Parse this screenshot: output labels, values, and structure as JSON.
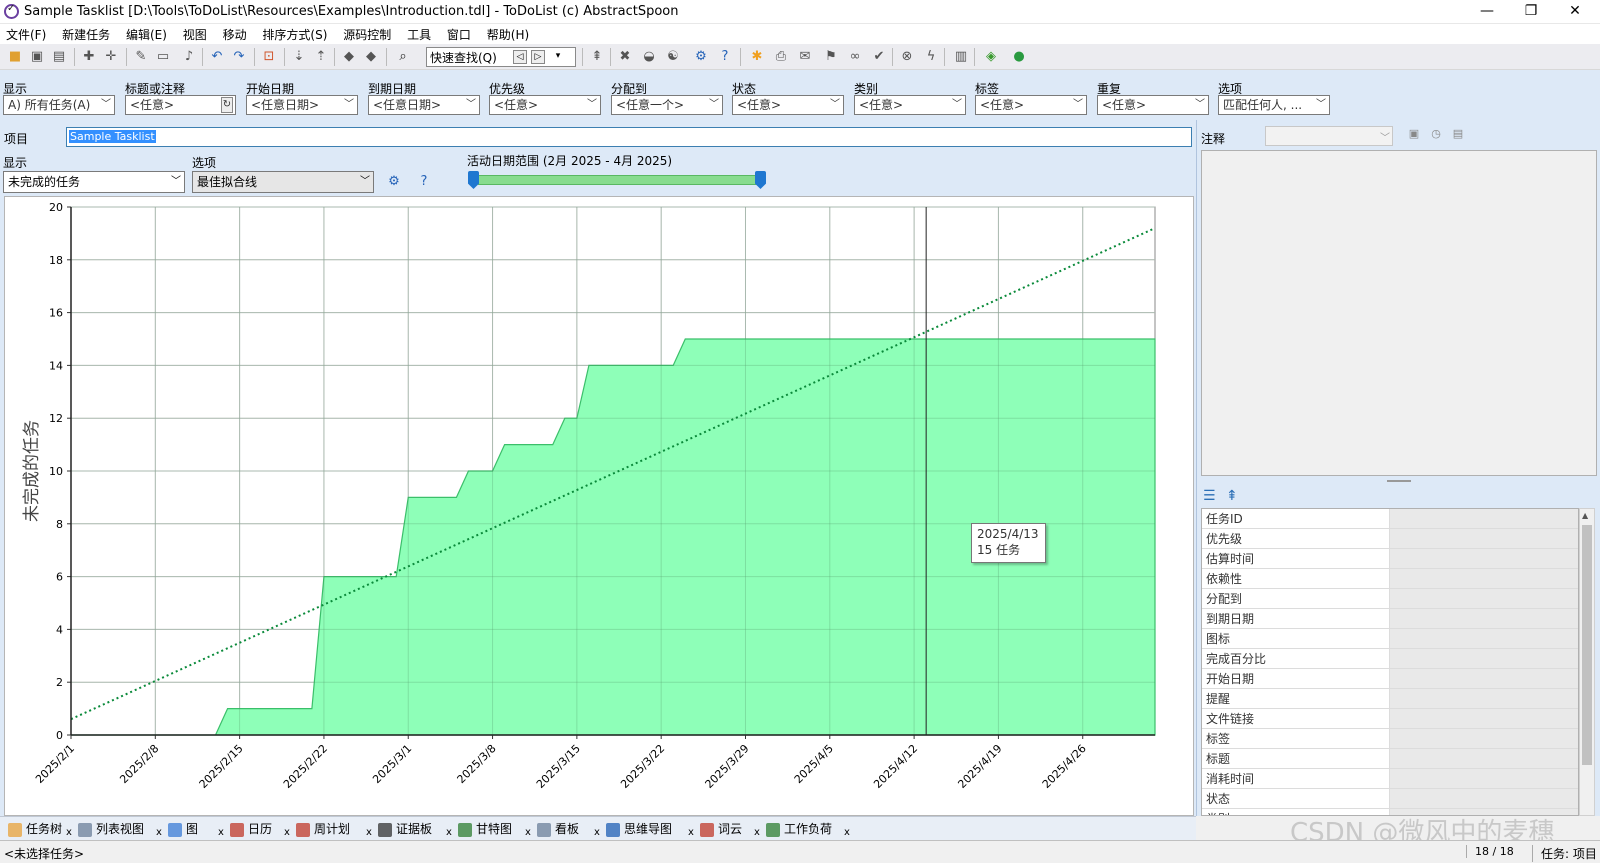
{
  "window": {
    "title": "Sample Tasklist [D:\\Tools\\ToDoList\\Resources\\Examples\\Introduction.tdl] - ToDoList (c) AbstractSpoon",
    "minimize": "—",
    "restore": "❐",
    "close": "✕"
  },
  "menu": [
    "文件(F)",
    "新建任务",
    "编辑(E)",
    "视图",
    "移动",
    "排序方式(S)",
    "源码控制",
    "工具",
    "窗口",
    "帮助(H)"
  ],
  "toolbar": {
    "quick_find": "快速查找(Q)"
  },
  "filters": [
    {
      "label": "显示",
      "value": "A)  所有任务(A)"
    },
    {
      "label": "标题或注释",
      "value": "<任意>"
    },
    {
      "label": "开始日期",
      "value": "<任意日期>"
    },
    {
      "label": "到期日期",
      "value": "<任意日期>"
    },
    {
      "label": "优先级",
      "value": "<任意>"
    },
    {
      "label": "分配到",
      "value": "<任意一个>"
    },
    {
      "label": "状态",
      "value": "<任意>"
    },
    {
      "label": "类别",
      "value": "<任意>"
    },
    {
      "label": "标签",
      "value": "<任意>"
    },
    {
      "label": "重复",
      "value": "<任意>"
    },
    {
      "label": "选项",
      "value": "匹配任何人, ..."
    }
  ],
  "project": {
    "label": "项目",
    "name": "Sample Tasklist"
  },
  "graph_controls": {
    "display_label": "显示",
    "display_value": "未完成的任务",
    "option_label": "选项",
    "option_value": "最佳拟合线",
    "range_label": "活动日期范围 (2月 2025 - 4月 2025)"
  },
  "tooltip": {
    "date": "2025/4/13",
    "count": "15 任务"
  },
  "chart_data": {
    "type": "area",
    "ylabel": "未完成的任务",
    "ylim": [
      0,
      20
    ],
    "yticks": [
      "0",
      "2",
      "4",
      "6",
      "8",
      "10",
      "12",
      "14",
      "16",
      "18",
      "20"
    ],
    "xticks": [
      "2025/2/1",
      "2025/2/8",
      "2025/2/15",
      "2025/2/22",
      "2025/3/1",
      "2025/3/8",
      "2025/3/15",
      "2025/3/22",
      "2025/3/29",
      "2025/4/5",
      "2025/4/12",
      "2025/4/19",
      "2025/4/26"
    ],
    "xrange": [
      "2025/2/1",
      "2025/5/2"
    ],
    "series": [
      {
        "type": "area",
        "color": "#88ffb4",
        "points": [
          [
            "2025/2/1",
            0
          ],
          [
            "2025/2/13",
            0
          ],
          [
            "2025/2/14",
            1
          ],
          [
            "2025/2/21",
            1
          ],
          [
            "2025/2/22",
            6
          ],
          [
            "2025/2/28",
            6
          ],
          [
            "2025/3/1",
            9
          ],
          [
            "2025/3/5",
            9
          ],
          [
            "2025/3/6",
            10
          ],
          [
            "2025/3/8",
            10
          ],
          [
            "2025/3/9",
            11
          ],
          [
            "2025/3/13",
            11
          ],
          [
            "2025/3/14",
            12
          ],
          [
            "2025/3/15",
            12
          ],
          [
            "2025/3/16",
            14
          ],
          [
            "2025/3/23",
            14
          ],
          [
            "2025/3/24",
            15
          ],
          [
            "2025/5/2",
            15
          ]
        ]
      },
      {
        "type": "trend",
        "color": "#0a8a3a",
        "points": [
          [
            "2025/2/1",
            0.6
          ],
          [
            "2025/5/2",
            19.2
          ]
        ]
      }
    ],
    "marker_date": "2025/4/13",
    "grid": true
  },
  "notes_panel": {
    "label": "注释"
  },
  "properties": [
    "任务ID",
    "优先级",
    "估算时间",
    "依赖性",
    "分配到",
    "到期日期",
    "图标",
    "完成百分比",
    "开始日期",
    "提醒",
    "文件链接",
    "标签",
    "标题",
    "消耗时间",
    "状态",
    "类别"
  ],
  "tabs": [
    {
      "label": "任务树",
      "icon": "task-tree-icon",
      "color": "#e8a23a"
    },
    {
      "label": "列表视图",
      "icon": "list-view-icon",
      "color": "#6b7f99"
    },
    {
      "label": "图",
      "icon": "graph-icon",
      "color": "#3a7bd5"
    },
    {
      "label": "日历",
      "icon": "calendar-icon",
      "color": "#c0392b"
    },
    {
      "label": "周计划",
      "icon": "week-planner-icon",
      "color": "#c0392b"
    },
    {
      "label": "证据板",
      "icon": "evidence-board-icon",
      "color": "#333333"
    },
    {
      "label": "甘特图",
      "icon": "gantt-icon",
      "color": "#2e7d32"
    },
    {
      "label": "看板",
      "icon": "kanban-icon",
      "color": "#6b7f99"
    },
    {
      "label": "思维导图",
      "icon": "mindmap-icon",
      "color": "#1f5fb4"
    },
    {
      "label": "词云",
      "icon": "word-cloud-icon",
      "color": "#c0392b"
    },
    {
      "label": "工作负荷",
      "icon": "workload-icon",
      "color": "#2e7d32"
    }
  ],
  "status": {
    "left": "<未选择任务>",
    "count": "18 / 18",
    "mode": "任务: 项目"
  },
  "watermark": "CSDN @微风中的麦穗"
}
